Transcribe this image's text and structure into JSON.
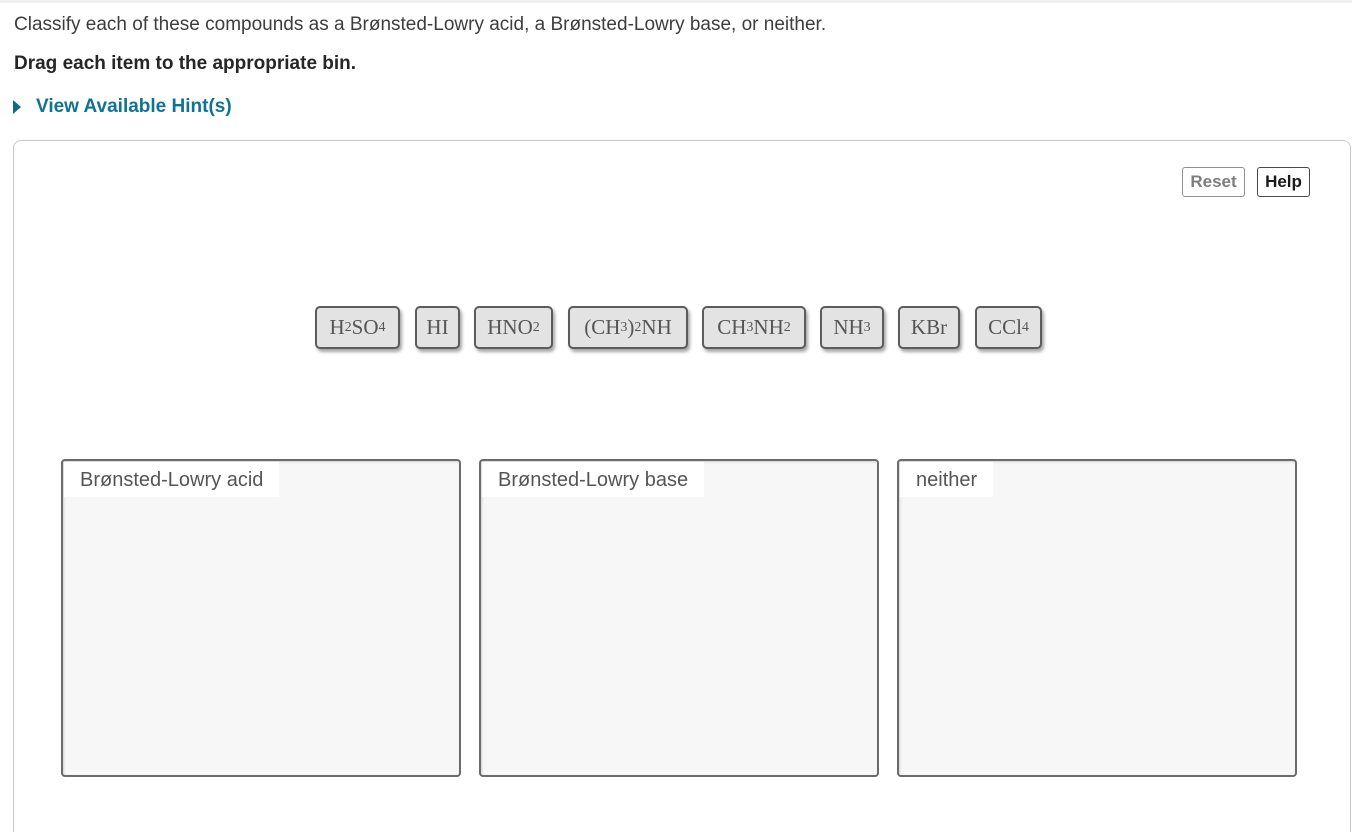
{
  "question": {
    "instruction": "Classify each of these compounds as a Brønsted-Lowry acid, a Brønsted-Lowry base, or neither.",
    "subinstruction": "Drag each item to the appropriate bin.",
    "hint_label": "View Available Hint(s)"
  },
  "toolbar": {
    "reset_label": "Reset",
    "help_label": "Help"
  },
  "tiles": [
    {
      "formula": "H2SO4",
      "parts": [
        {
          "t": "H"
        },
        {
          "s": "2"
        },
        {
          "t": "SO"
        },
        {
          "s": "4"
        }
      ]
    },
    {
      "formula": "HI",
      "parts": [
        {
          "t": "HI"
        }
      ]
    },
    {
      "formula": "HNO2",
      "parts": [
        {
          "t": "HNO"
        },
        {
          "s": "2"
        }
      ]
    },
    {
      "formula": "(CH3)2NH",
      "parts": [
        {
          "t": "(CH"
        },
        {
          "s": "3"
        },
        {
          "t": ")"
        },
        {
          "s": "2"
        },
        {
          "t": "NH"
        }
      ]
    },
    {
      "formula": "CH3NH2",
      "parts": [
        {
          "t": "CH"
        },
        {
          "s": "3"
        },
        {
          "t": "NH"
        },
        {
          "s": "2"
        }
      ]
    },
    {
      "formula": "NH3",
      "parts": [
        {
          "t": "NH"
        },
        {
          "s": "3"
        }
      ]
    },
    {
      "formula": "KBr",
      "parts": [
        {
          "t": "KBr"
        }
      ]
    },
    {
      "formula": "CCl4",
      "parts": [
        {
          "t": "CCl"
        },
        {
          "s": "4"
        }
      ]
    }
  ],
  "bins": [
    {
      "label": "Brønsted-Lowry acid",
      "items": []
    },
    {
      "label": "Brønsted-Lowry base",
      "items": []
    },
    {
      "label": "neither",
      "items": []
    }
  ],
  "colors": {
    "hint_link": "#0f7494",
    "tile_background": "#e3e3e3",
    "bin_background": "#f7f7f7"
  },
  "icons": {
    "hint_toggle": "caret-right-icon"
  }
}
